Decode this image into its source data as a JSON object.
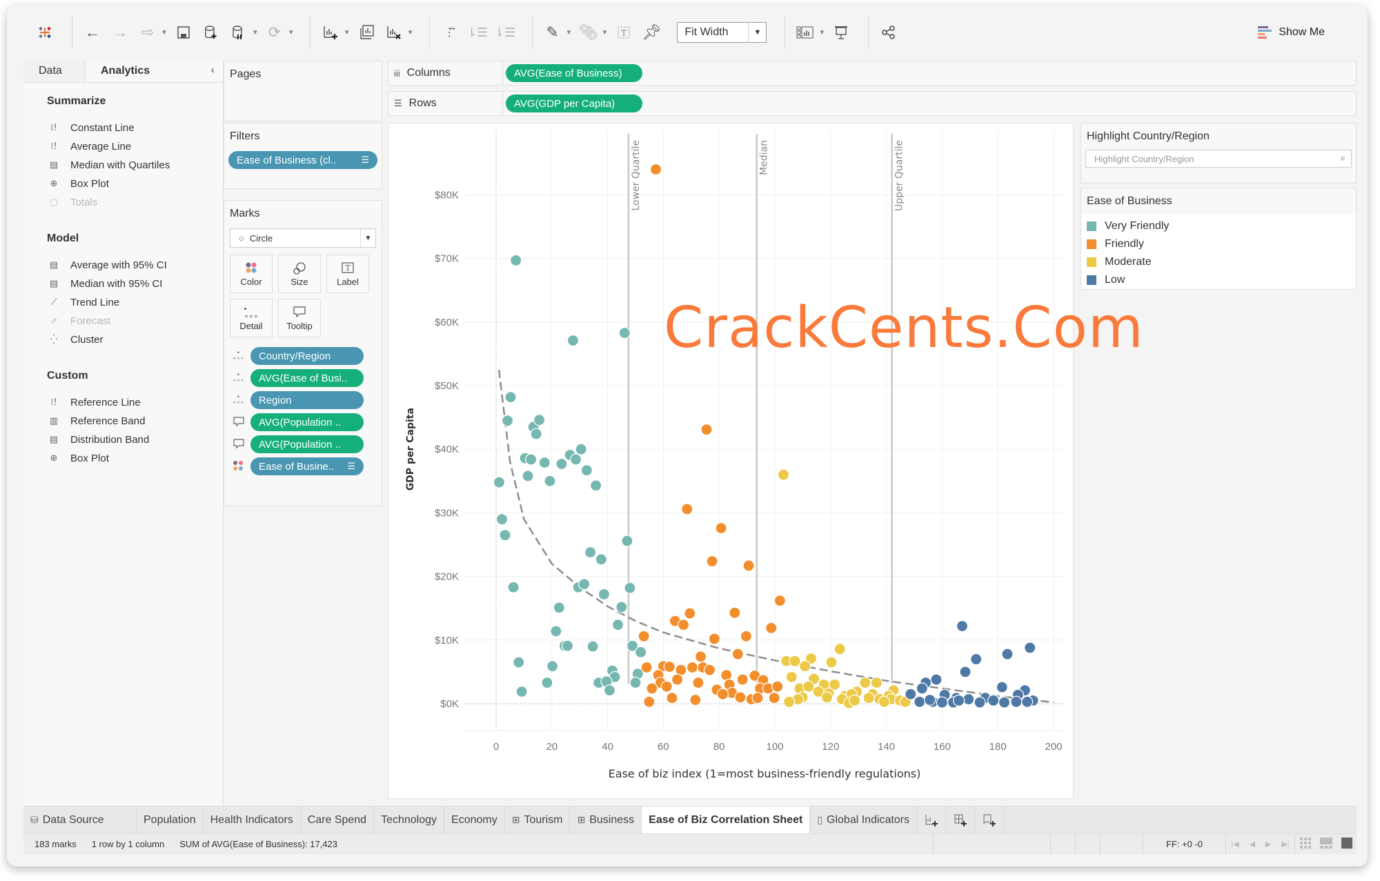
{
  "toolbar": {
    "fit_select": "Fit Width",
    "show_me": "Show Me",
    "icons": [
      "tableau-logo-icon",
      "undo-icon",
      "redo-icon",
      "replay-icon",
      "save-icon",
      "new-data-source-icon",
      "pause-updates-icon",
      "refresh-icon",
      "new-worksheet-icon",
      "duplicate-sheet-icon",
      "clear-sheet-icon",
      "swap-rows-columns-icon",
      "sort-ascending-icon",
      "sort-descending-icon",
      "highlight-icon",
      "group-icon",
      "show-labels-icon",
      "fix-axes-pin-icon",
      "show-cards-icon",
      "presentation-mode-icon",
      "share-icon"
    ]
  },
  "left_pane": {
    "tabs": [
      "Data",
      "Analytics"
    ],
    "active_tab": "Analytics",
    "collapse": "‹",
    "sections": [
      {
        "title": "Summarize",
        "items": [
          {
            "label": "Constant Line",
            "icon": "reference-line-icon",
            "disabled": false
          },
          {
            "label": "Average Line",
            "icon": "reference-line-icon",
            "disabled": false
          },
          {
            "label": "Median with Quartiles",
            "icon": "distribution-band-icon",
            "disabled": false
          },
          {
            "label": "Box Plot",
            "icon": "box-plot-icon",
            "disabled": false
          },
          {
            "label": "Totals",
            "icon": "totals-icon",
            "disabled": true
          }
        ]
      },
      {
        "title": "Model",
        "items": [
          {
            "label": "Average with 95% CI",
            "icon": "distribution-band-icon",
            "disabled": false
          },
          {
            "label": "Median with 95% CI",
            "icon": "distribution-band-icon",
            "disabled": false
          },
          {
            "label": "Trend Line",
            "icon": "trend-line-icon",
            "disabled": false
          },
          {
            "label": "Forecast",
            "icon": "forecast-icon",
            "disabled": true
          },
          {
            "label": "Cluster",
            "icon": "cluster-icon",
            "disabled": false
          }
        ]
      },
      {
        "title": "Custom",
        "items": [
          {
            "label": "Reference Line",
            "icon": "reference-line-icon",
            "disabled": false
          },
          {
            "label": "Reference Band",
            "icon": "reference-band-icon",
            "disabled": false
          },
          {
            "label": "Distribution Band",
            "icon": "distribution-band-icon",
            "disabled": false
          },
          {
            "label": "Box Plot",
            "icon": "box-plot-icon",
            "disabled": false
          }
        ]
      }
    ]
  },
  "pages": {
    "title": "Pages"
  },
  "filters": {
    "title": "Filters",
    "pills": [
      {
        "label": "Ease of Business (cl..",
        "type": "blue"
      }
    ]
  },
  "marks": {
    "title": "Marks",
    "mark_type": "Circle",
    "buttons": [
      "Color",
      "Size",
      "Label",
      "Detail",
      "Tooltip"
    ],
    "fields": [
      {
        "icon": "detail-icon",
        "label": "Country/Region",
        "type": "blue"
      },
      {
        "icon": "detail-icon",
        "label": "AVG(Ease of Busi..",
        "type": "green"
      },
      {
        "icon": "detail-icon",
        "label": "Region",
        "type": "blue"
      },
      {
        "icon": "tooltip-icon",
        "label": "AVG(Population ..",
        "type": "green"
      },
      {
        "icon": "tooltip-icon",
        "label": "AVG(Population ..",
        "type": "green"
      },
      {
        "icon": "color-icon",
        "label": "Ease of Busine..",
        "type": "blue"
      }
    ]
  },
  "shelves": {
    "columns_label": "Columns",
    "columns_pill": "AVG(Ease of Business)",
    "rows_label": "Rows",
    "rows_pill": "AVG(GDP per Capita)"
  },
  "highlight": {
    "title": "Highlight Country/Region",
    "placeholder": "Highlight Country/Region"
  },
  "legend": {
    "title": "Ease of Business",
    "items": [
      {
        "label": "Very Friendly",
        "color": "#76b7b2"
      },
      {
        "label": "Friendly",
        "color": "#f28e2b"
      },
      {
        "label": "Moderate",
        "color": "#edc948"
      },
      {
        "label": "Low",
        "color": "#4e79a7"
      }
    ]
  },
  "watermark": "CrackCents.Com",
  "sheet_tabs": [
    {
      "label": "Data Source",
      "icon": "database-icon",
      "active": false
    },
    {
      "label": "Population",
      "icon": "",
      "active": false
    },
    {
      "label": "Health Indicators",
      "icon": "",
      "active": false
    },
    {
      "label": "Care Spend",
      "icon": "",
      "active": false
    },
    {
      "label": "Technology",
      "icon": "",
      "active": false
    },
    {
      "label": "Economy",
      "icon": "",
      "active": false
    },
    {
      "label": "Tourism",
      "icon": "dashboard-icon",
      "active": false
    },
    {
      "label": "Business",
      "icon": "dashboard-icon",
      "active": false
    },
    {
      "label": "Ease of Biz Correlation Sheet",
      "icon": "",
      "active": true
    },
    {
      "label": "Global Indicators",
      "icon": "story-icon",
      "active": false
    }
  ],
  "status": {
    "marks": "183 marks",
    "rows_cols": "1 row by 1 column",
    "sum": "SUM of AVG(Ease of Business): 17,423",
    "ff": "FF: +0 -0"
  },
  "chart_data": {
    "type": "scatter",
    "title": "",
    "xlabel": "Ease of biz index (1=most business-friendly regulations)",
    "ylabel": "GDP per Capita",
    "xlim": [
      -10,
      203
    ],
    "ylim": [
      -10,
      88
    ],
    "x_ticks": [
      0,
      20,
      40,
      60,
      80,
      100,
      120,
      140,
      160,
      180,
      200
    ],
    "y_ticks": [
      0,
      10,
      20,
      30,
      40,
      50,
      60,
      70,
      80
    ],
    "y_tick_labels": [
      "$0K",
      "$10K",
      "$20K",
      "$30K",
      "$40K",
      "$50K",
      "$60K",
      "$70K",
      "$80K"
    ],
    "grid": true,
    "reference_lines": [
      {
        "label": "Lower Quartile",
        "x": 47.5
      },
      {
        "label": "Median",
        "x": 93.5
      },
      {
        "label": "Upper Quartile",
        "x": 142
      }
    ],
    "trend_line": {
      "type": "logarithmic",
      "style": "dashed",
      "points": [
        [
          1,
          52.5
        ],
        [
          5,
          38
        ],
        [
          10,
          29
        ],
        [
          20,
          22
        ],
        [
          30,
          18.3
        ],
        [
          40,
          15.3
        ],
        [
          50,
          13
        ],
        [
          60,
          11.2
        ],
        [
          80,
          8.7
        ],
        [
          100,
          6.8
        ],
        [
          120,
          5.1
        ],
        [
          140,
          3.6
        ],
        [
          160,
          2.4
        ],
        [
          180,
          1.2
        ],
        [
          200,
          0.2
        ]
      ]
    },
    "series": [
      {
        "name": "Very Friendly",
        "color": "#76b7b2",
        "points": [
          [
            7.1,
            69.7
          ],
          [
            27.6,
            57.1
          ],
          [
            46.1,
            58.3
          ],
          [
            5.2,
            48.2
          ],
          [
            4.1,
            44.5
          ],
          [
            13.4,
            43.5
          ],
          [
            15.5,
            44.6
          ],
          [
            14.4,
            42.4
          ],
          [
            10.4,
            38.6
          ],
          [
            12.5,
            38.4
          ],
          [
            17.4,
            37.9
          ],
          [
            23.5,
            37.7
          ],
          [
            26.5,
            39.1
          ],
          [
            28.6,
            38.4
          ],
          [
            30.5,
            40
          ],
          [
            32.5,
            36.7
          ],
          [
            35.8,
            34.3
          ],
          [
            11.4,
            35.8
          ],
          [
            19.3,
            35
          ],
          [
            1.1,
            34.8
          ],
          [
            2.1,
            29
          ],
          [
            3.2,
            26.5
          ],
          [
            47,
            25.6
          ],
          [
            33.8,
            23.8
          ],
          [
            37.7,
            22.7
          ],
          [
            6.2,
            18.3
          ],
          [
            29.5,
            18.3
          ],
          [
            31.6,
            18.8
          ],
          [
            48,
            18.2
          ],
          [
            38.7,
            17.2
          ],
          [
            45,
            15.2
          ],
          [
            22.6,
            15.1
          ],
          [
            43.7,
            12.4
          ],
          [
            21.5,
            11.4
          ],
          [
            24.6,
            9.1
          ],
          [
            25.6,
            9.1
          ],
          [
            34.7,
            9
          ],
          [
            48.9,
            9.1
          ],
          [
            51.9,
            8.1
          ],
          [
            8.1,
            6.5
          ],
          [
            20.2,
            5.9
          ],
          [
            41.7,
            5.2
          ],
          [
            42.6,
            4.2
          ],
          [
            50.8,
            4.7
          ],
          [
            18.3,
            3.3
          ],
          [
            36.8,
            3.3
          ],
          [
            39.6,
            3.5
          ],
          [
            50,
            3.3
          ],
          [
            9.2,
            1.9
          ],
          [
            40.7,
            2.1
          ]
        ]
      },
      {
        "name": "Friendly",
        "color": "#f28e2b",
        "points": [
          [
            57.3,
            84
          ],
          [
            75.5,
            43.1
          ],
          [
            68.5,
            30.6
          ],
          [
            80.7,
            27.6
          ],
          [
            77.5,
            22.4
          ],
          [
            90.6,
            21.7
          ],
          [
            101.8,
            16.2
          ],
          [
            85.6,
            14.3
          ],
          [
            69.5,
            14.2
          ],
          [
            64.2,
            13
          ],
          [
            67.2,
            12.4
          ],
          [
            98.7,
            11.9
          ],
          [
            53,
            10.6
          ],
          [
            78.3,
            10.2
          ],
          [
            89.7,
            10.6
          ],
          [
            86.7,
            7.8
          ],
          [
            73.4,
            7.4
          ],
          [
            54,
            5.7
          ],
          [
            60,
            5.9
          ],
          [
            62.2,
            5.8
          ],
          [
            66.3,
            5.3
          ],
          [
            70.4,
            5.7
          ],
          [
            74.2,
            5.7
          ],
          [
            76.6,
            5.3
          ],
          [
            58.2,
            4.5
          ],
          [
            82.6,
            4.5
          ],
          [
            92.8,
            4.4
          ],
          [
            95.8,
            3.7
          ],
          [
            65,
            3.8
          ],
          [
            59,
            3.3
          ],
          [
            72.5,
            3.3
          ],
          [
            88.4,
            3.8
          ],
          [
            83.7,
            3
          ],
          [
            61.2,
            2.7
          ],
          [
            55.9,
            2.4
          ],
          [
            79.2,
            2.2
          ],
          [
            84.6,
            1.7
          ],
          [
            81.3,
            1.5
          ],
          [
            94.7,
            2.4
          ],
          [
            97.6,
            2.4
          ],
          [
            100.9,
            2.7
          ],
          [
            63.1,
            0.9
          ],
          [
            87.6,
            1
          ],
          [
            91.6,
            0.7
          ],
          [
            99.8,
            0.9
          ],
          [
            93.8,
            0.9
          ],
          [
            54.9,
            0.3
          ],
          [
            71.5,
            0.6
          ]
        ]
      },
      {
        "name": "Moderate",
        "color": "#edc948",
        "points": [
          [
            103.1,
            36
          ],
          [
            123.3,
            8.6
          ],
          [
            104.1,
            6.7
          ],
          [
            107.2,
            6.7
          ],
          [
            113,
            7.1
          ],
          [
            120.3,
            6.5
          ],
          [
            110.8,
            5.9
          ],
          [
            106,
            4.2
          ],
          [
            114,
            3.9
          ],
          [
            132.4,
            3.3
          ],
          [
            136.5,
            3.3
          ],
          [
            108.9,
            2.4
          ],
          [
            112.1,
            2.7
          ],
          [
            117.6,
            3
          ],
          [
            121.4,
            3
          ],
          [
            129.4,
            1.9
          ],
          [
            142.6,
            2.1
          ],
          [
            115.6,
            1.9
          ],
          [
            119.3,
            1.6
          ],
          [
            125,
            1.2
          ],
          [
            127.5,
            1.5
          ],
          [
            135.1,
            1.5
          ],
          [
            140.8,
            1.2
          ],
          [
            109.9,
            1
          ],
          [
            124.1,
            0.7
          ],
          [
            133.7,
            0.9
          ],
          [
            137.6,
            0.7
          ],
          [
            141.7,
            0.7
          ],
          [
            144.9,
            0.5
          ],
          [
            108.3,
            0.7
          ],
          [
            105.1,
            0.3
          ],
          [
            126.6,
            0.1
          ],
          [
            118.7,
            1
          ],
          [
            139.2,
            0.3
          ],
          [
            146.8,
            0.3
          ],
          [
            128.6,
            0.5
          ]
        ]
      },
      {
        "name": "Low",
        "color": "#4e79a7",
        "points": [
          [
            167.2,
            12.2
          ],
          [
            191.5,
            8.8
          ],
          [
            183.4,
            7.8
          ],
          [
            172.2,
            7
          ],
          [
            168.3,
            5
          ],
          [
            181.5,
            2.6
          ],
          [
            157.9,
            3.8
          ],
          [
            154.1,
            3.3
          ],
          [
            189.7,
            2.1
          ],
          [
            148.7,
            1.5
          ],
          [
            152.8,
            2.4
          ],
          [
            160.9,
            1.4
          ],
          [
            165.1,
            0.9
          ],
          [
            169.5,
            0.7
          ],
          [
            175.5,
            0.9
          ],
          [
            178.4,
            0.5
          ],
          [
            187.2,
            1.4
          ],
          [
            192.6,
            0.5
          ],
          [
            151.9,
            0.3
          ],
          [
            156.6,
            0.3
          ],
          [
            160,
            0.2
          ],
          [
            164,
            0.2
          ],
          [
            173.5,
            0.2
          ],
          [
            182.3,
            0.2
          ],
          [
            186.6,
            0.3
          ],
          [
            190.5,
            0.3
          ],
          [
            155.6,
            0.6
          ],
          [
            166,
            0.5
          ]
        ]
      }
    ]
  }
}
